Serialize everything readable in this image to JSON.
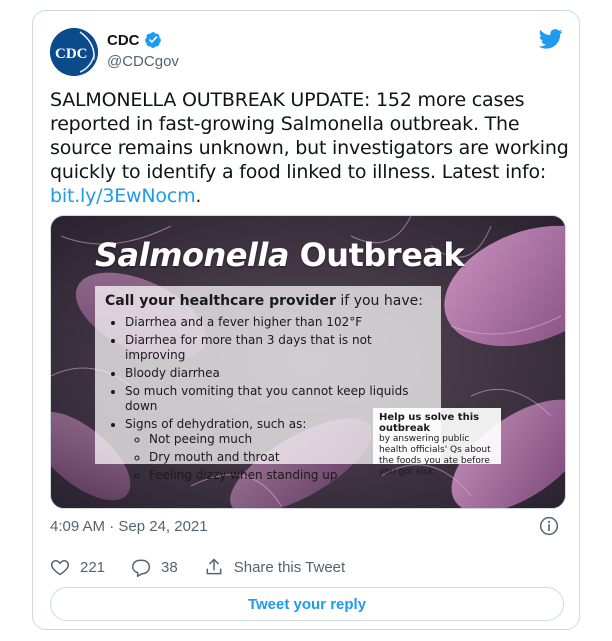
{
  "author": {
    "name": "CDC",
    "handle": "@CDCgov",
    "avatar_text": "CDC",
    "verified": true
  },
  "tweet": {
    "text": "SALMONELLA OUTBREAK UPDATE: 152 more cases reported in fast-growing Salmonella outbreak. The source remains unknown, but investigators are working quickly to identify a food linked to illness. Latest info: ",
    "link": "bit.ly/3EwNocm",
    "text_end": "."
  },
  "media": {
    "title_italic": "Salmonella",
    "title_rest": " Outbreak",
    "box_head_bold": "Call your healthcare provider",
    "box_head_rest": " if you have:",
    "bullets": [
      "Diarrhea and a fever higher than 102°F",
      "Diarrhea for more than 3 days that is not improving",
      "Bloody diarrhea",
      "So much vomiting that you cannot keep liquids down",
      "Signs of dehydration, such as:"
    ],
    "sub_bullets": [
      "Not peeing much",
      "Dry mouth and throat",
      "Feeling dizzy when standing up"
    ],
    "help_bold": "Help us solve this outbreak",
    "help_text": "by answering public health officials' Qs about the foods you ate before you got sick."
  },
  "timestamp": "4:09 AM · Sep 24, 2021",
  "actions": {
    "likes": "221",
    "replies": "38",
    "share_label": "Share this Tweet"
  },
  "reply_button": "Tweet your reply",
  "colors": {
    "accent": "#1d9bf0",
    "border": "#cfd9de",
    "muted": "#536471",
    "cdc_blue": "#0b4a8b"
  },
  "icons": [
    "verified-badge-icon",
    "twitter-bird-icon",
    "info-icon",
    "heart-icon",
    "reply-icon",
    "share-icon"
  ]
}
